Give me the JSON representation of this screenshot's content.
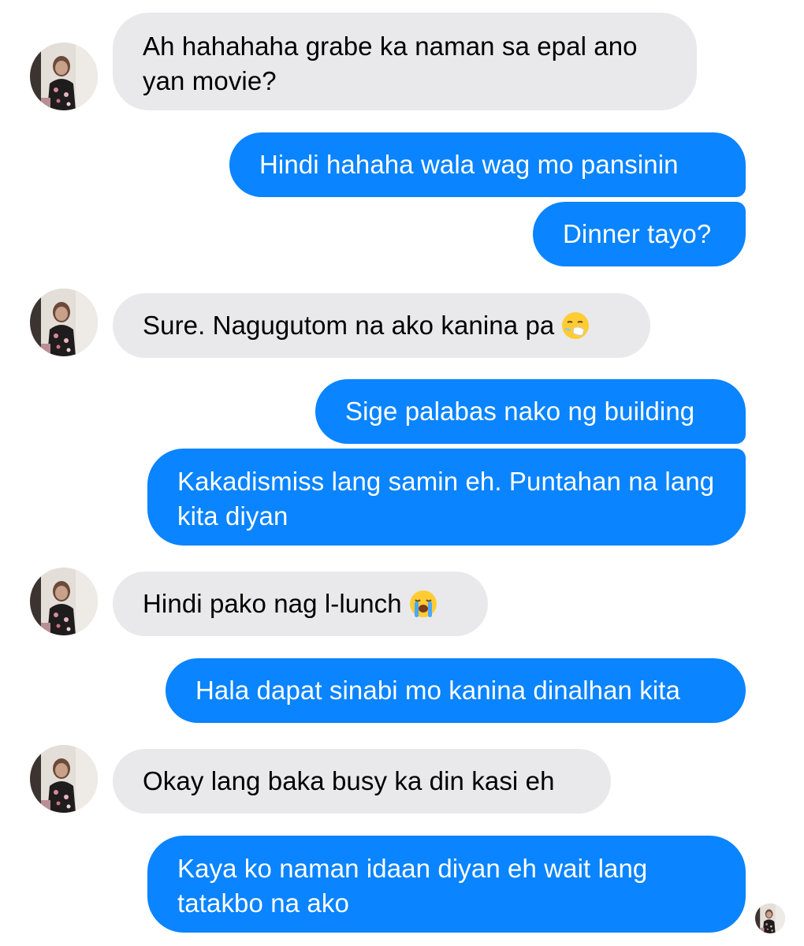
{
  "colors": {
    "incoming_bubble": "#e9e9eb",
    "outgoing_bubble": "#0a84ff",
    "incoming_text": "#000000",
    "outgoing_text": "#ffffff"
  },
  "messages": [
    {
      "sender": "contact",
      "text": "Ah hahahaha grabe ka naman sa epal ano yan movie?"
    },
    {
      "sender": "me",
      "text": "Hindi hahaha wala wag mo pansinin"
    },
    {
      "sender": "me",
      "text": "Dinner tayo?"
    },
    {
      "sender": "contact",
      "text": "Sure. Nagugutom na ako kanina pa",
      "emoji": "sneezing-face-icon"
    },
    {
      "sender": "me",
      "text": "Sige palabas nako ng building"
    },
    {
      "sender": "me",
      "text": "Kakadismiss lang samin eh. Puntahan na lang kita diyan"
    },
    {
      "sender": "contact",
      "text": "Hindi pako nag l-lunch",
      "emoji": "loudly-crying-face-icon"
    },
    {
      "sender": "me",
      "text": "Hala dapat sinabi mo kanina dinalhan kita"
    },
    {
      "sender": "contact",
      "text": "Okay lang baka busy ka din kasi eh"
    },
    {
      "sender": "me",
      "text": "Kaya ko naman idaan diyan eh wait lang tatakbo na ako"
    }
  ],
  "icons": {
    "contact_avatar": "contact-avatar",
    "read_receipt": "read-receipt-avatar"
  }
}
